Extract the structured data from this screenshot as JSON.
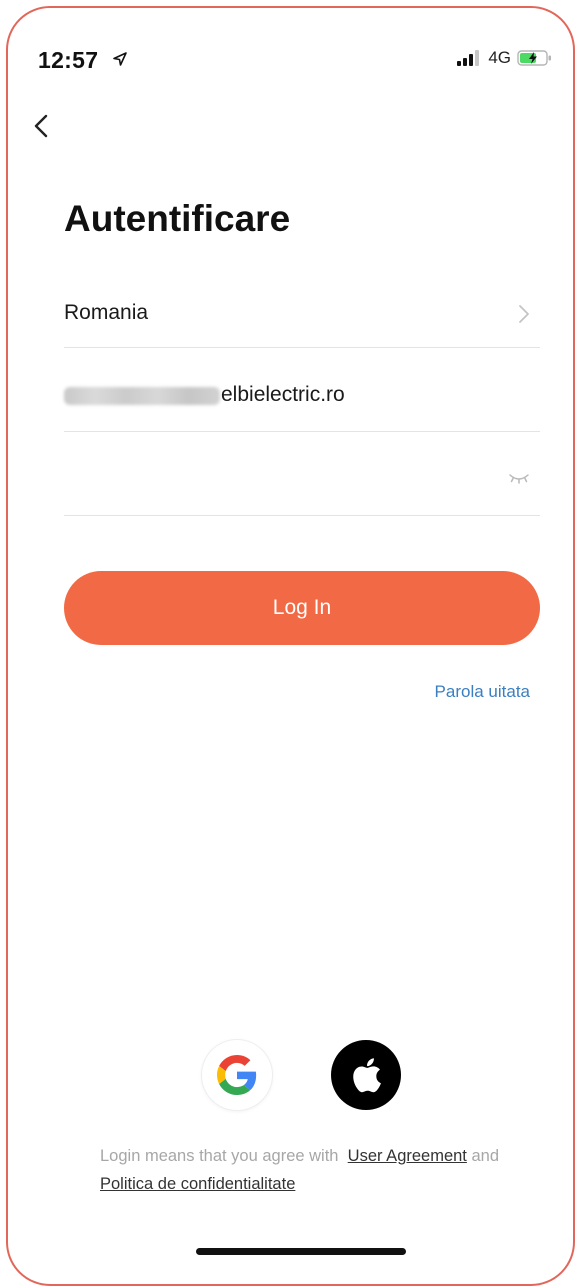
{
  "status_bar": {
    "time": "12:57",
    "network": "4G"
  },
  "page": {
    "title": "Autentificare"
  },
  "form": {
    "country": "Romania",
    "email_visible_suffix": "elbielectric.ro",
    "password_value": "",
    "login_button_label": "Log In",
    "forgot_password_label": "Parola uitata"
  },
  "social_login": {
    "google_icon": "google-icon",
    "apple_icon": "apple-icon"
  },
  "agreement": {
    "prefix": "Login means that you agree with",
    "user_agreement_label": "User Agreement",
    "conjunction": "and",
    "privacy_label": "Politica de confidentialitate"
  },
  "colors": {
    "frame_border": "#e2675a",
    "accent": "#f16a45",
    "link": "#3b7fc0",
    "battery_charging": "#4cd964"
  }
}
